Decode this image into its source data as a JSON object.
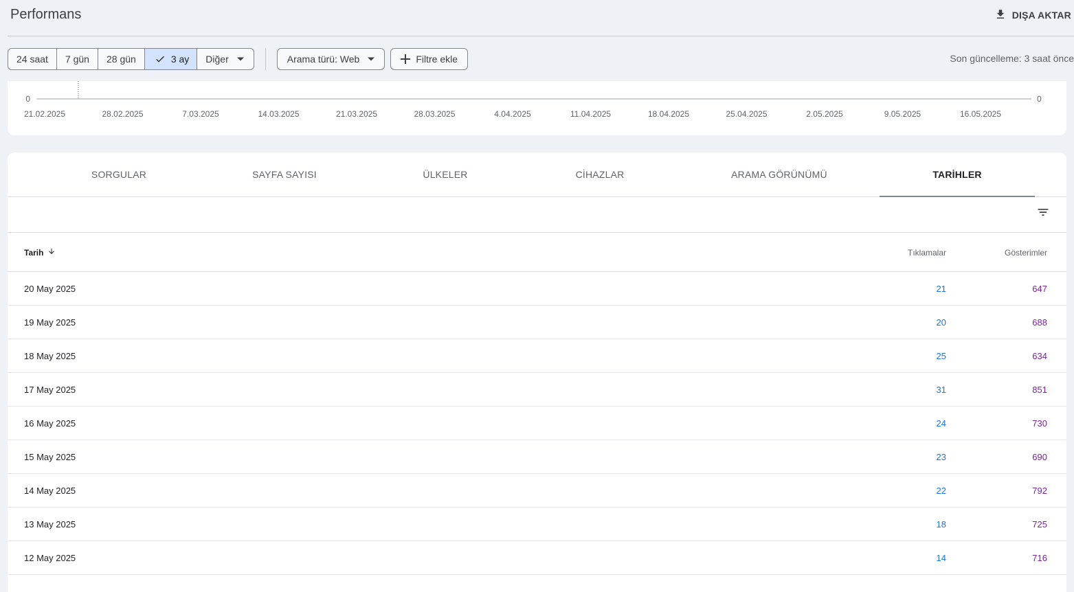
{
  "header": {
    "title": "Performans",
    "export_label": "DIŞA AKTAR"
  },
  "toolbar": {
    "date_ranges": [
      {
        "label": "24 saat",
        "active": false
      },
      {
        "label": "7 gün",
        "active": false
      },
      {
        "label": "28 gün",
        "active": false
      },
      {
        "label": "3 ay",
        "active": true
      },
      {
        "label": "Diğer",
        "active": false
      }
    ],
    "search_type_label": "Arama türü: Web",
    "add_filter_label": "Filtre ekle",
    "last_update": "Son güncelleme: 3 saat önce"
  },
  "chart": {
    "y_left_zero": "0",
    "y_right_zero": "0",
    "x_ticks": [
      "21.02.2025",
      "28.02.2025",
      "7.03.2025",
      "14.03.2025",
      "21.03.2025",
      "28.03.2025",
      "4.04.2025",
      "11.04.2025",
      "18.04.2025",
      "25.04.2025",
      "2.05.2025",
      "9.05.2025",
      "16.05.2025"
    ]
  },
  "tabs": [
    {
      "label": "SORGULAR",
      "active": false
    },
    {
      "label": "SAYFA SAYISI",
      "active": false
    },
    {
      "label": "ÜLKELER",
      "active": false
    },
    {
      "label": "CİHAZLAR",
      "active": false
    },
    {
      "label": "ARAMA GÖRÜNÜMÜ",
      "active": false
    },
    {
      "label": "TARİHLER",
      "active": true
    }
  ],
  "table": {
    "columns": {
      "date": "Tarih",
      "clicks": "Tıklamalar",
      "impressions": "Gösterimler"
    },
    "rows": [
      {
        "date": "20 May 2025",
        "clicks": "21",
        "impressions": "647"
      },
      {
        "date": "19 May 2025",
        "clicks": "20",
        "impressions": "688"
      },
      {
        "date": "18 May 2025",
        "clicks": "25",
        "impressions": "634"
      },
      {
        "date": "17 May 2025",
        "clicks": "31",
        "impressions": "851"
      },
      {
        "date": "16 May 2025",
        "clicks": "24",
        "impressions": "730"
      },
      {
        "date": "15 May 2025",
        "clicks": "23",
        "impressions": "690"
      },
      {
        "date": "14 May 2025",
        "clicks": "22",
        "impressions": "792"
      },
      {
        "date": "13 May 2025",
        "clicks": "18",
        "impressions": "725"
      },
      {
        "date": "12 May 2025",
        "clicks": "14",
        "impressions": "716"
      }
    ]
  },
  "colors": {
    "clicks": "#1a73e8",
    "impressions": "#7b1fa2",
    "active_segment": "#d3e3fd"
  }
}
